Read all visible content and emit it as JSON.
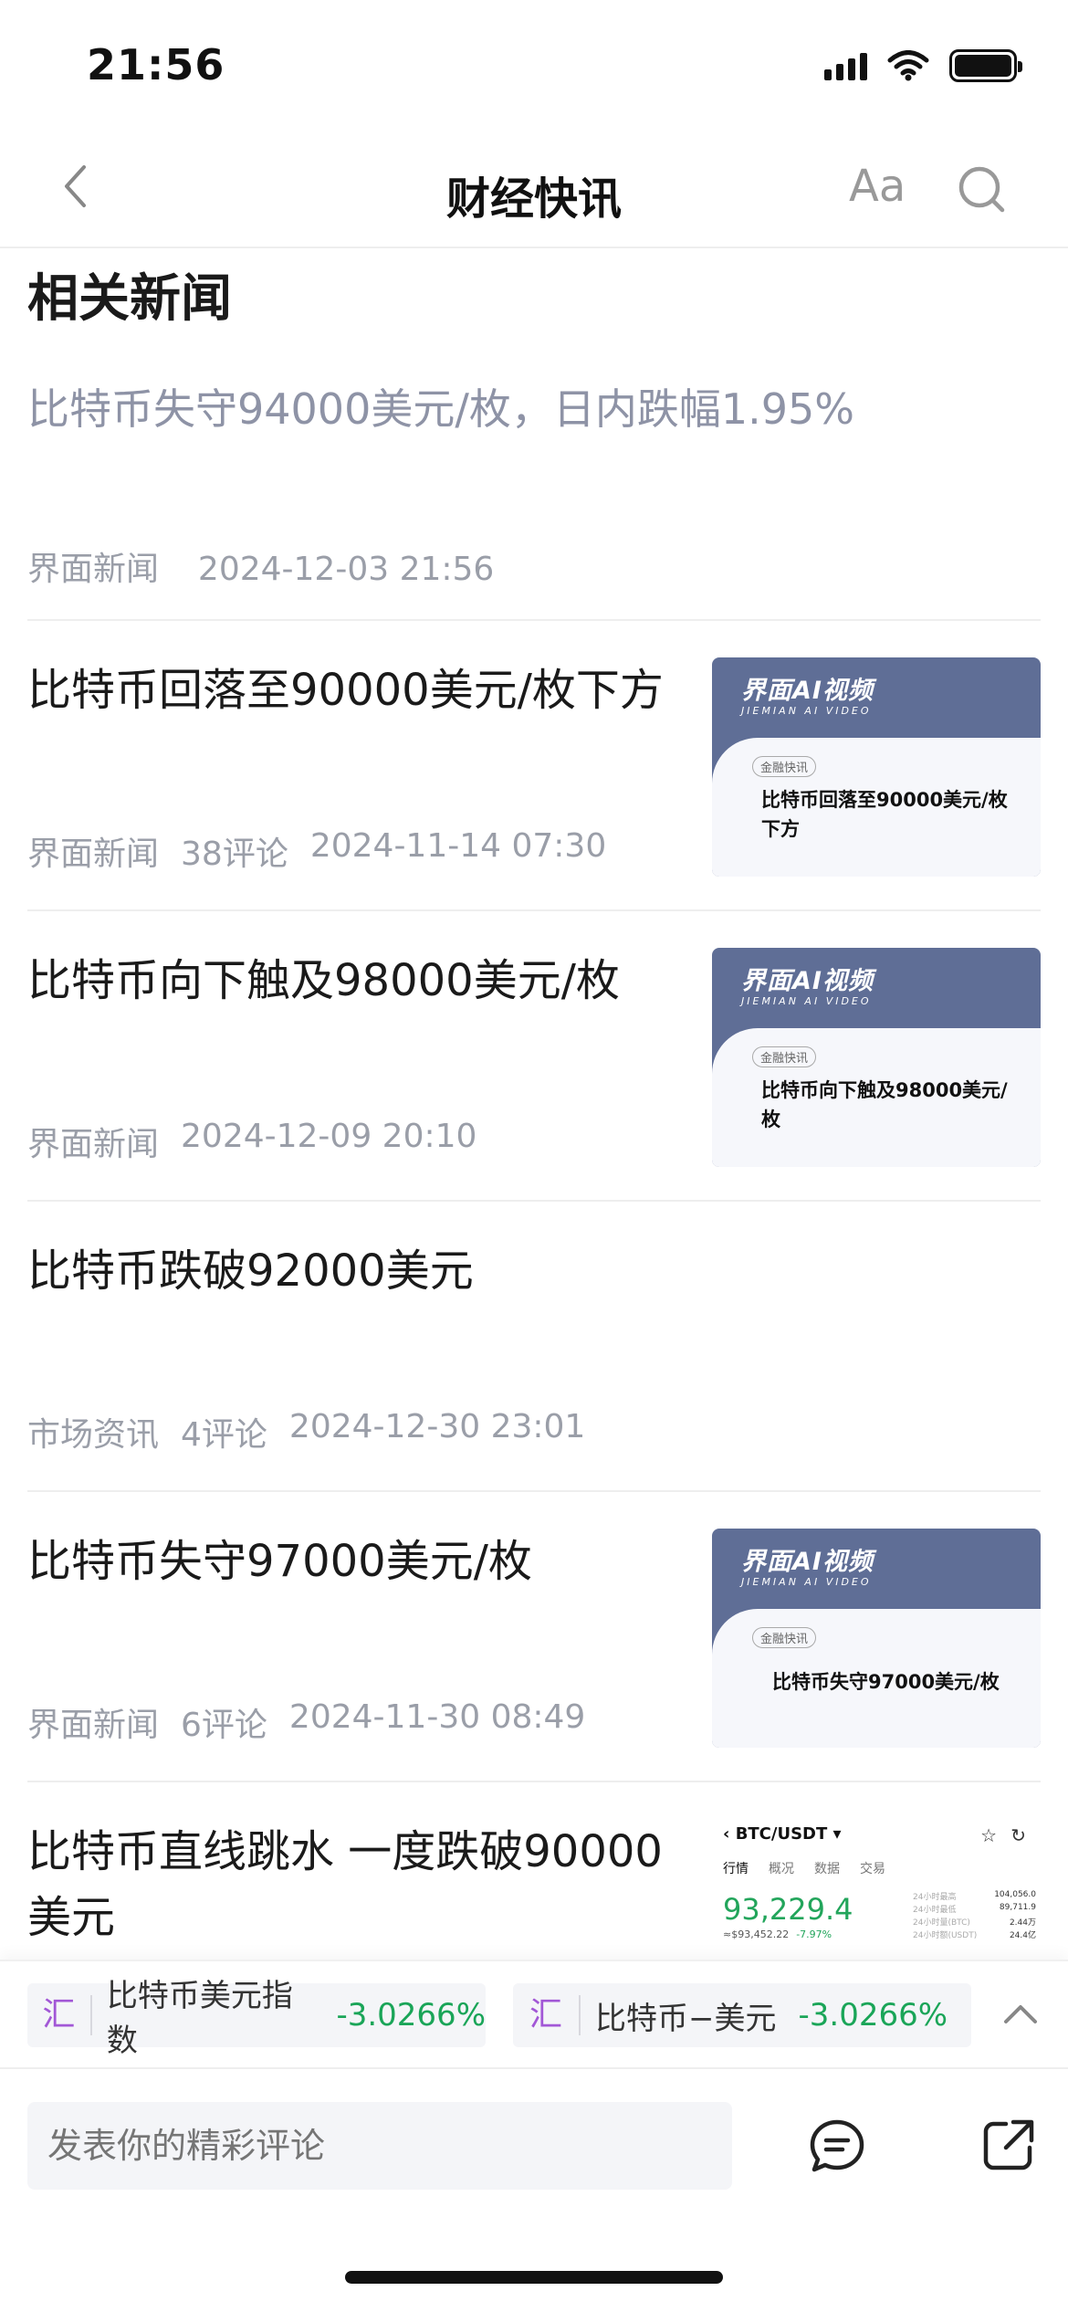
{
  "status_bar": {
    "time": "21:56"
  },
  "nav": {
    "title": "财经快讯",
    "font_label": "Aa"
  },
  "section": {
    "title": "相关新闻"
  },
  "first_news": {
    "headline": "比特币失守94000美元/枚，日内跌幅1.95%",
    "source": "界面新闻",
    "time": "2024-12-03 21:56"
  },
  "news": [
    {
      "headline": "比特币回落至90000美元/枚下方",
      "source": "界面新闻",
      "comments": "38评论",
      "time": "2024-11-14 07:30",
      "thumb": {
        "brand": "界面AI视频",
        "brand_sub": "JIEMIAN AI VIDEO",
        "tag": "金融快讯",
        "title": "比特币回落至90000美元/枚下方"
      }
    },
    {
      "headline": "比特币向下触及98000美元/枚",
      "source": "界面新闻",
      "time": "2024-12-09 20:10",
      "thumb": {
        "brand": "界面AI视频",
        "brand_sub": "JIEMIAN AI VIDEO",
        "tag": "金融快讯",
        "title": "比特币向下触及98000美元/枚"
      }
    },
    {
      "headline": "比特币跌破92000美元",
      "source": "市场资讯",
      "comments": "4评论",
      "time": "2024-12-30 23:01"
    },
    {
      "headline": "比特币失守97000美元/枚",
      "source": "界面新闻",
      "comments": "6评论",
      "time": "2024-11-30 08:49",
      "thumb": {
        "brand": "界面AI视频",
        "brand_sub": "JIEMIAN AI VIDEO",
        "tag": "金融快讯",
        "title": "比特币失守97000美元/枚"
      }
    },
    {
      "headline": "比特币直线跳水 一度跌破90000美元",
      "chart_thumb": {
        "pair": "BTC/USDT",
        "tabs": [
          "行情",
          "概况",
          "数据",
          "交易"
        ],
        "price": "93,229.4",
        "sub_price": "≈$93,452.22",
        "sub_change": "-7.97%",
        "stats": [
          {
            "label": "24小时最高",
            "value": "104,056.0"
          },
          {
            "label": "24小时最低",
            "value": "89,711.9"
          },
          {
            "label": "24小时量(BTC)",
            "value": "2.44万"
          },
          {
            "label": "24小时额(USDT)",
            "value": "24.4亿"
          }
        ]
      }
    }
  ],
  "tickers": [
    {
      "icon": "汇",
      "name": "比特币美元指数",
      "change": "-3.0266%"
    },
    {
      "icon": "汇",
      "name": "比特币−美元",
      "change": "-3.0266%"
    }
  ],
  "comment": {
    "placeholder": "发表你的精彩评论"
  },
  "colors": {
    "positive_green": "#1aa558",
    "hui_purple": "#a257d6",
    "meta_gray": "#9a9ea8",
    "thumb_blue": "#5f6e96"
  }
}
